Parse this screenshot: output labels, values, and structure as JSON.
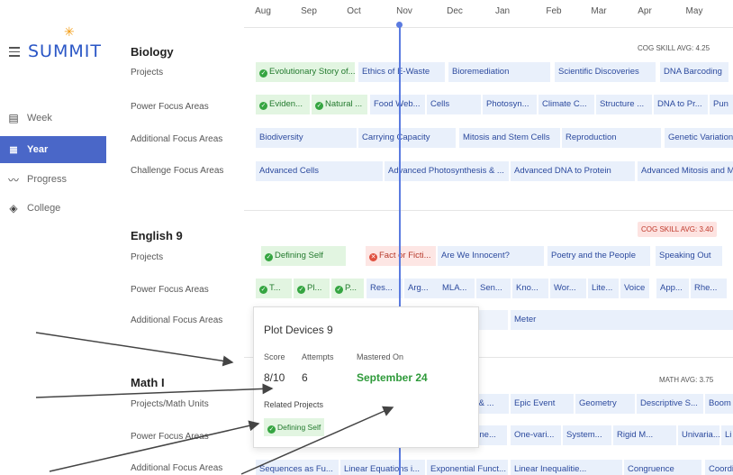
{
  "sidebar": {
    "logo": "SUMMIT",
    "items": [
      {
        "label": "Week",
        "icon": "calendar-week-icon",
        "active": false
      },
      {
        "label": "Year",
        "icon": "list-icon",
        "active": true
      },
      {
        "label": "Progress",
        "icon": "trend-icon",
        "active": false
      },
      {
        "label": "College",
        "icon": "graduation-cap-icon",
        "active": false
      }
    ]
  },
  "timeline": {
    "months": [
      "Aug",
      "Sep",
      "Oct",
      "Nov",
      "Dec",
      "Jan",
      "Feb",
      "Mar",
      "Apr",
      "May"
    ]
  },
  "biology": {
    "title": "Biology",
    "avg": "COG SKILL AVG: 4.25",
    "labels": [
      "Projects",
      "Power Focus Areas",
      "Additional Focus Areas",
      "Challenge Focus Areas"
    ],
    "projects": [
      "Evolutionary Story of...",
      "Ethics of E-Waste",
      "Bioremediation",
      "Scientific Discoveries",
      "DNA Barcoding"
    ],
    "power": [
      "Eviden...",
      "Natural ...",
      "Food Web...",
      "Cells",
      "Photosyn...",
      "Climate C...",
      "Structure ...",
      "DNA to Pr...",
      "Pun"
    ],
    "additional": [
      "Biodiversity",
      "Carrying Capacity",
      "Mitosis and Stem Cells",
      "Reproduction",
      "Genetic Variation"
    ],
    "challenge": [
      "Advanced Cells",
      "Advanced Photosynthesis & ...",
      "Advanced DNA to Protein",
      "Advanced Mitosis and M"
    ]
  },
  "english": {
    "title": "English 9",
    "avg": "COG SKILL AVG: 3.40",
    "labels": [
      "Projects",
      "Power Focus Areas",
      "Additional Focus Areas"
    ],
    "projects": [
      "Defining Self",
      "Fact or Ficti...",
      "Are We Innocent?",
      "Poetry and the People",
      "Speaking Out"
    ],
    "power": [
      "T...",
      "Pl...",
      "P...",
      "Res...",
      "Arg...",
      "MLA...",
      "Sen...",
      "Kno...",
      "Wor...",
      "Lite...",
      "Voice",
      "App...",
      "Rhe..."
    ],
    "additional": [
      "Meter"
    ]
  },
  "math": {
    "title": "Math I",
    "avg": "MATH AVG: 3.75",
    "labels": [
      "Projects/Math Units",
      "Power Focus Areas",
      "Additional Focus Areas"
    ],
    "projects": [
      "ns & ...",
      "Epic Event",
      "Geometry",
      "Descriptive S...",
      "Boom"
    ],
    "power": [
      "One...",
      "One-vari...",
      "System...",
      "Rigid M...",
      "Univaria...",
      "Li"
    ],
    "additional": [
      "Sequences as Fu...",
      "Linear Equations i...",
      "Exponential Funct...",
      "Linear Inequalitie...",
      "Congruence",
      "Coordinate"
    ]
  },
  "popup": {
    "title": "Plot Devices 9",
    "score_label": "Score",
    "attempts_label": "Attempts",
    "mastered_label": "Mastered On",
    "score": "8/10",
    "attempts": "6",
    "mastered": "September 24",
    "related_label": "Related Projects",
    "related": "Defining Self"
  },
  "colors": {
    "accent": "#4a67c8",
    "chip_blue": "#e9f0fb",
    "chip_green": "#e2f5e1",
    "chip_red": "#fde6e4",
    "now_line": "#5b7be0"
  }
}
